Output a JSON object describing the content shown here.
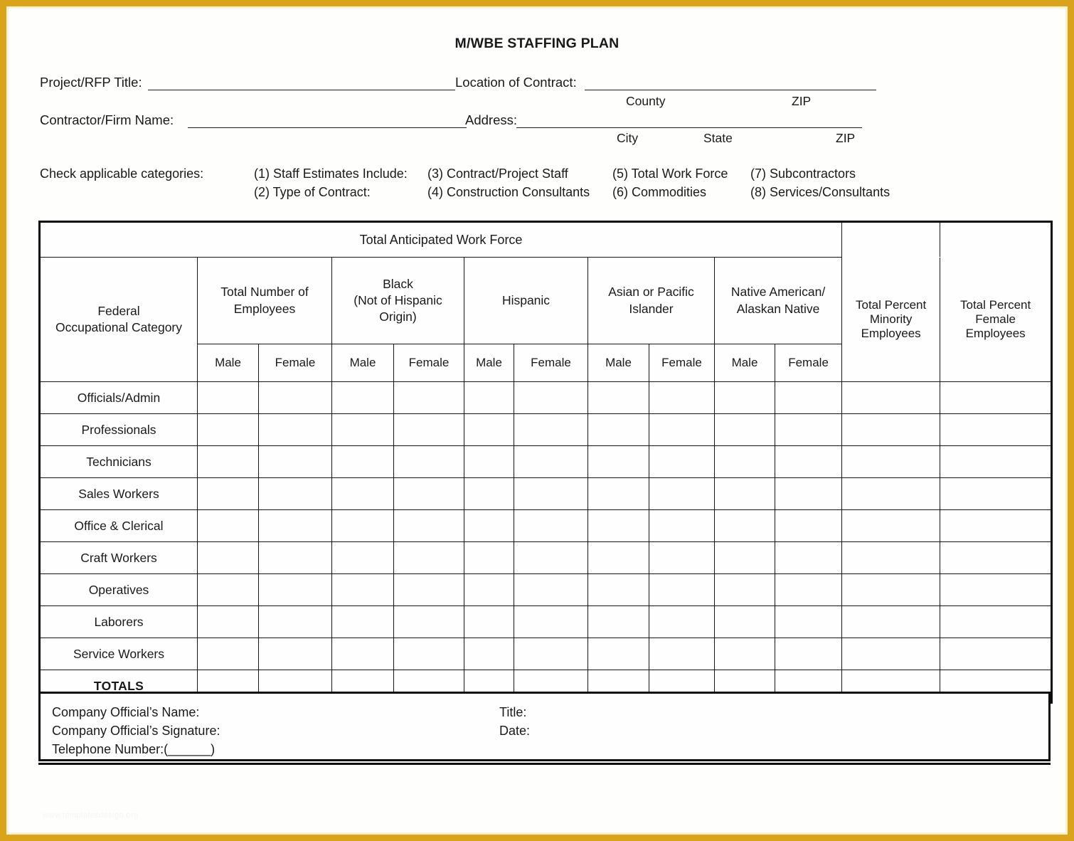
{
  "document": {
    "title": "M/WBE STAFFING PLAN",
    "watermark": "www.templatesdesign.org"
  },
  "header": {
    "project_title_label": "Project/RFP Title:",
    "location_label": "Location of Contract:",
    "county_caption": "County",
    "zip_caption_1": "ZIP",
    "contractor_label": "Contractor/Firm Name:",
    "address_label": "Address:",
    "city_caption": "City",
    "state_caption": "State",
    "zip_caption_2": "ZIP"
  },
  "categories": {
    "prompt": "Check applicable categories:",
    "items": [
      {
        "text": "(1) Staff Estimates Include:"
      },
      {
        "text": "(2) Type of Contract:"
      },
      {
        "text": "(3) Contract/Project Staff"
      },
      {
        "text": "(4) Construction Consultants"
      },
      {
        "text": "(5) Total Work Force"
      },
      {
        "text": "(6) Commodities"
      },
      {
        "text": "(7) Subcontractors"
      },
      {
        "text": "(8) Services/Consultants"
      }
    ]
  },
  "table": {
    "banner": "Total Anticipated Work Force",
    "col_category": "Federal\nOccupational Category",
    "col_category_line1": "Federal",
    "col_category_line2": "Occupational Category",
    "groups": [
      {
        "line1": "Total Number of",
        "line2": "Employees",
        "line3": ""
      },
      {
        "line1": "Black",
        "line2": "(Not of Hispanic",
        "line3": "Origin)"
      },
      {
        "line1": "Hispanic",
        "line2": "",
        "line3": ""
      },
      {
        "line1": "Asian or Pacific",
        "line2": "Islander",
        "line3": ""
      },
      {
        "line1": "Native American/",
        "line2": "Alaskan Native",
        "line3": ""
      }
    ],
    "pct_minority": {
      "line1": "Total Percent",
      "line2": "Minority",
      "line3": "Employees"
    },
    "pct_female": {
      "line1": "Total Percent",
      "line2": "Female",
      "line3": "Employees"
    },
    "sex_headers": [
      "Male",
      "Female",
      "Male",
      "Female",
      "Male",
      "Female",
      "Male",
      "Female",
      "Male",
      "Female"
    ],
    "rows": [
      {
        "label": "Officials/Admin"
      },
      {
        "label": "Professionals"
      },
      {
        "label": "Technicians"
      },
      {
        "label": "Sales Workers"
      },
      {
        "label": "Office & Clerical"
      },
      {
        "label": "Craft Workers"
      },
      {
        "label": "Operatives"
      },
      {
        "label": "Laborers"
      },
      {
        "label": "Service Workers"
      }
    ],
    "totals_label": "TOTALS"
  },
  "signature": {
    "name_label": "Company Official’s Name:",
    "signature_label": "Company Official’s Signature:",
    "telephone_label": "Telephone Number:(______)",
    "title_label": "Title:",
    "date_label": "Date:"
  },
  "colors": {
    "border_accent": "#D9A41C",
    "rule": "#202020",
    "table_line": "#151515",
    "paper": "#fefefd"
  }
}
